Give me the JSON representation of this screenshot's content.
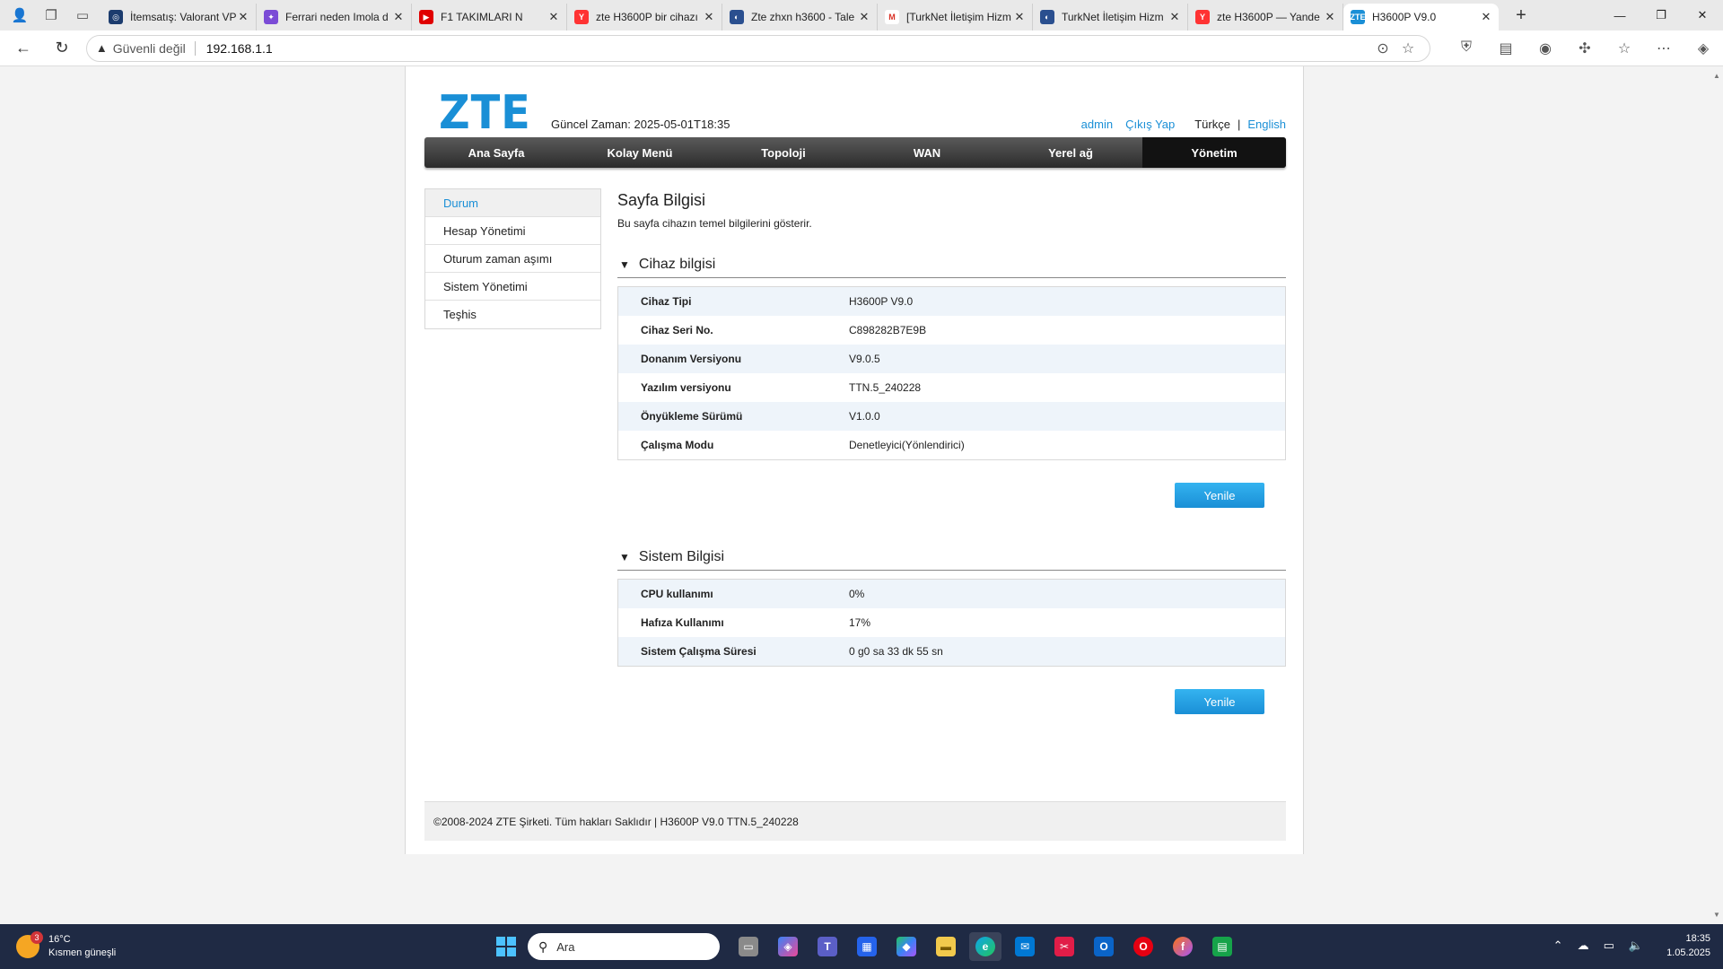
{
  "browser": {
    "tabs": [
      {
        "title": "İtemsatış: Valorant VP",
        "fav_color": "#1c3c6e",
        "fav_text": "◎"
      },
      {
        "title": "Ferrari neden Imola d",
        "fav_color": "#7b4bd6",
        "fav_text": "✦"
      },
      {
        "title": "F1 TAKIMLARI N",
        "fav_color": "#e00000",
        "fav_text": "▶"
      },
      {
        "title": "zte H3600P bir cihazı",
        "fav_color": "#f33",
        "fav_text": "Y"
      },
      {
        "title": "Zte zhxn h3600 - Tale",
        "fav_color": "#2a4f8f",
        "fav_text": "◐"
      },
      {
        "title": "[TurkNet İletişim Hizm",
        "fav_color": "#ffffff",
        "fav_text": "M"
      },
      {
        "title": "TurkNet İletişim Hizm",
        "fav_color": "#2a4f8f",
        "fav_text": "◐"
      },
      {
        "title": "zte H3600P — Yande",
        "fav_color": "#f33",
        "fav_text": "Y"
      },
      {
        "title": "H3600P V9.0",
        "fav_color": "#1a8fd6",
        "fav_text": "ZTE"
      }
    ],
    "address": {
      "security_label": "Güvenli değil",
      "url": "192.168.1.1"
    }
  },
  "router": {
    "logo": "ZTE",
    "current_time_label": "Güncel Zaman:",
    "current_time": "2025-05-01T18:35",
    "user": "admin",
    "logout": "Çıkış Yap",
    "lang_tr": "Türkçe",
    "lang_sep": "|",
    "lang_en": "English",
    "nav": [
      "Ana Sayfa",
      "Kolay Menü",
      "Topoloji",
      "WAN",
      "Yerel ağ",
      "Yönetim"
    ],
    "sidebar": [
      "Durum",
      "Hesap Yönetimi",
      "Oturum zaman aşımı",
      "Sistem Yönetimi",
      "Teşhis"
    ],
    "page_title": "Sayfa Bilgisi",
    "page_desc": "Bu sayfa cihazın temel bilgilerini gösterir.",
    "device_section": {
      "title": "Cihaz bilgisi",
      "rows": [
        {
          "label": "Cihaz Tipi",
          "value": "H3600P V9.0"
        },
        {
          "label": "Cihaz Seri No.",
          "value": "C898282B7E9B"
        },
        {
          "label": "Donanım Versiyonu",
          "value": "V9.0.5"
        },
        {
          "label": "Yazılım versiyonu",
          "value": "TTN.5_240228"
        },
        {
          "label": "Önyükleme Sürümü",
          "value": "V1.0.0"
        },
        {
          "label": "Çalışma Modu",
          "value": "Denetleyici(Yönlendirici)"
        }
      ],
      "refresh": "Yenile"
    },
    "system_section": {
      "title": "Sistem Bilgisi",
      "rows": [
        {
          "label": "CPU kullanımı",
          "value": "0%"
        },
        {
          "label": "Hafıza Kullanımı",
          "value": "17%"
        },
        {
          "label": "Sistem Çalışma Süresi",
          "value": "0 g0 sa 33 dk 55 sn"
        }
      ],
      "refresh": "Yenile"
    },
    "footer": "©2008-2024 ZTE Şirketi. Tüm hakları Saklıdır  |   H3600P V9.0 TTN.5_240228"
  },
  "taskbar": {
    "weather_temp": "16°C",
    "weather_desc": "Kısmen güneşli",
    "weather_badge": "3",
    "search_placeholder": "Ara",
    "time": "18:35",
    "date": "1.05.2025"
  }
}
